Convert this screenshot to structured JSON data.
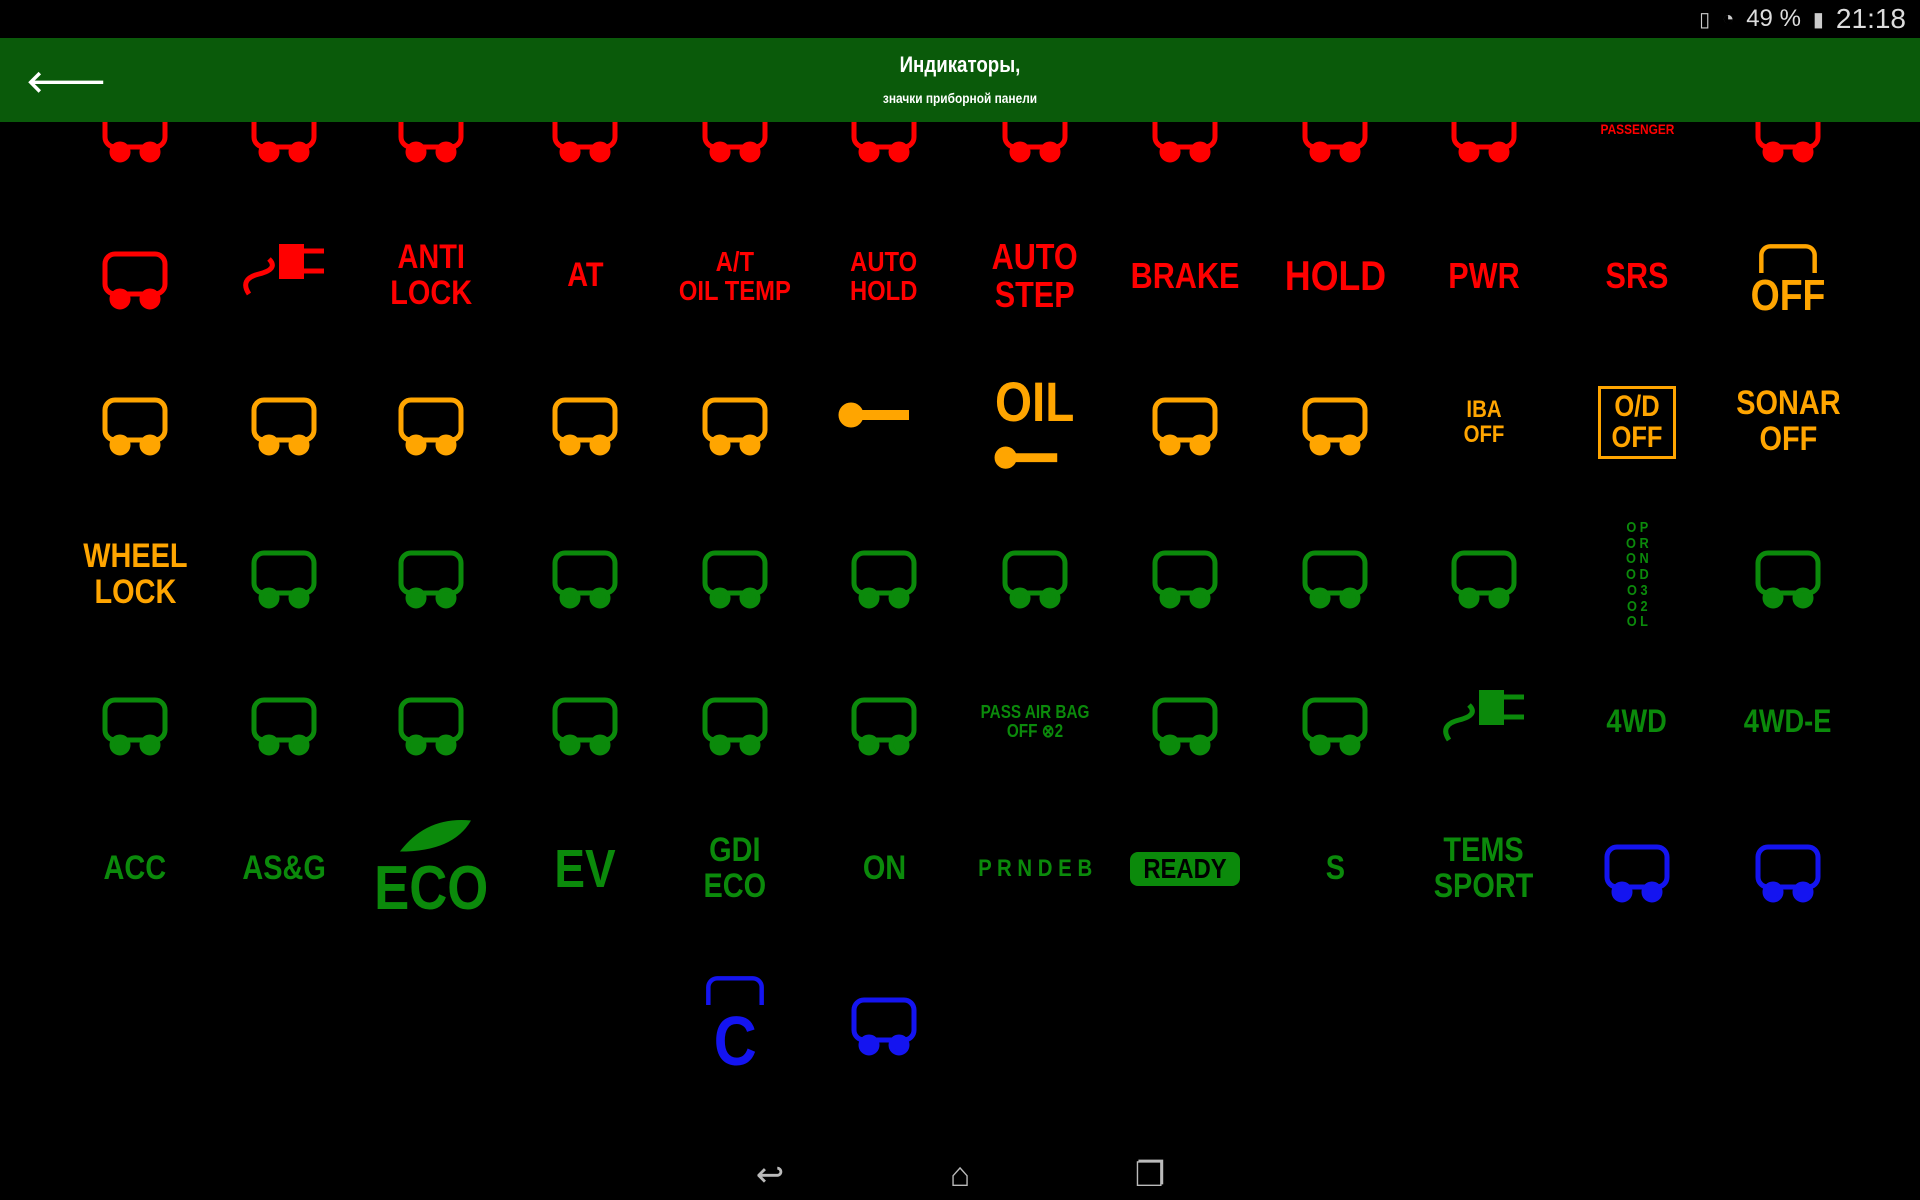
{
  "status_bar": {
    "battery": "49 %",
    "time": "21:18",
    "icons": [
      "vibrate-icon",
      "wifi-icon",
      "battery-icon"
    ]
  },
  "header": {
    "title": "Индикаторы,",
    "subtitle": "значки приборной панели",
    "back_icon": "arrow-left-icon"
  },
  "colors": {
    "red": "#ff0000",
    "orange": "#ffa500",
    "green": "#0b8a0b",
    "blue": "#1414f0",
    "header": "#0a5a0a"
  },
  "rows": [
    [
      {
        "c": "red",
        "icon": "seat-heater"
      },
      {
        "c": "red",
        "icon": "coolant-level"
      },
      {
        "c": "red",
        "icon": "gear-warning"
      },
      {
        "c": "red",
        "icon": "fuel"
      },
      {
        "c": "red",
        "icon": "washer-level"
      },
      {
        "c": "red",
        "icon": "battery"
      },
      {
        "c": "red",
        "icon": "trunk-open"
      },
      {
        "c": "red",
        "icon": "glow-plug"
      },
      {
        "c": "red",
        "icon": "oil-can"
      },
      {
        "c": "red",
        "icon": "seatbelt"
      },
      {
        "c": "red",
        "text": [
          "PASSENGER"
        ],
        "s": 14
      },
      {
        "c": "red",
        "icon": "airbag"
      }
    ],
    [
      {
        "c": "red",
        "icon": "glow-heater"
      },
      {
        "c": "red",
        "icon": "plug"
      },
      {
        "c": "red",
        "text": [
          "ANTI",
          "LOCK"
        ],
        "s": 34
      },
      {
        "c": "red",
        "text": [
          "AT"
        ],
        "s": 34
      },
      {
        "c": "red",
        "text": [
          "A/T",
          "OIL TEMP"
        ],
        "s": 28
      },
      {
        "c": "red",
        "text": [
          "AUTO",
          "HOLD"
        ],
        "s": 28
      },
      {
        "c": "red",
        "text": [
          "AUTO",
          "STEP"
        ],
        "s": 36
      },
      {
        "c": "red",
        "text": [
          "BRAKE"
        ],
        "s": 36
      },
      {
        "c": "red",
        "text": [
          "HOLD"
        ],
        "s": 42
      },
      {
        "c": "red",
        "text": [
          "PWR"
        ],
        "s": 36
      },
      {
        "c": "red",
        "text": [
          "SRS"
        ],
        "s": 36
      },
      {
        "c": "orange",
        "icon": "sonar-car",
        "text": [
          "OFF"
        ],
        "s": 44
      }
    ],
    [
      {
        "c": "orange",
        "icon": "lane-car"
      },
      {
        "c": "orange",
        "icon": "rear-fog"
      },
      {
        "c": "orange",
        "icon": "windshield-washer"
      },
      {
        "c": "orange",
        "icon": "oil-drip"
      },
      {
        "c": "orange",
        "icon": "coolant-tank"
      },
      {
        "c": "orange",
        "icon": "wrench"
      },
      {
        "c": "orange",
        "text": [
          "OIL"
        ],
        "s": 56,
        "icon2": "wrench"
      },
      {
        "c": "orange",
        "icon": "engine"
      },
      {
        "c": "orange",
        "icon": "brake-circle"
      },
      {
        "c": "orange",
        "text": [
          "IBA",
          "OFF"
        ],
        "s": 24
      },
      {
        "c": "orange",
        "text": [
          "O/D",
          "OFF"
        ],
        "s": 30,
        "boxed": true
      },
      {
        "c": "orange",
        "text": [
          "SONAR",
          "OFF"
        ],
        "s": 34
      }
    ],
    [
      {
        "c": "orange",
        "text": [
          "WHEEL",
          "LOCK"
        ],
        "s": 34
      },
      {
        "c": "green",
        "icon": "auto-stop"
      },
      {
        "c": "green",
        "icon": "parking-p"
      },
      {
        "c": "green",
        "icon": "drivetrain"
      },
      {
        "c": "green",
        "icon": "drivetrain-full"
      },
      {
        "c": "green",
        "icon": "axle"
      },
      {
        "c": "green",
        "icon": "diff-lock"
      },
      {
        "c": "green",
        "icon": "4wd-box"
      },
      {
        "c": "green",
        "icon": "4l-box"
      },
      {
        "c": "green",
        "icon": "car-arrows"
      },
      {
        "c": "green",
        "text": [
          "O P",
          "O R",
          "O N",
          "O D",
          "O 3",
          "O 2",
          "O L"
        ],
        "s": 15
      },
      {
        "c": "green",
        "icon": "sonar-car"
      }
    ],
    [
      {
        "c": "green",
        "icon": "car-front"
      },
      {
        "c": "green",
        "icon": "parking-sensors"
      },
      {
        "c": "green",
        "icon": "lane-assist"
      },
      {
        "c": "green",
        "icon": "lane-car"
      },
      {
        "c": "green",
        "icon": "side-lights"
      },
      {
        "c": "green",
        "icon": "front-fog"
      },
      {
        "c": "green",
        "text": [
          "PASS AIR BAG",
          "OFF ⊗2"
        ],
        "s": 18
      },
      {
        "c": "green",
        "icon": "turn-signals"
      },
      {
        "c": "green",
        "icon": "tire-arrow"
      },
      {
        "c": "green",
        "icon": "plug"
      },
      {
        "c": "green",
        "text": [
          "4WD"
        ],
        "s": 32
      },
      {
        "c": "green",
        "text": [
          "4WD-E"
        ],
        "s": 32
      }
    ],
    [
      {
        "c": "green",
        "text": [
          "ACC"
        ],
        "s": 34
      },
      {
        "c": "green",
        "text": [
          "AS&G"
        ],
        "s": 34
      },
      {
        "c": "green",
        "text": [
          "ECO"
        ],
        "s": 62,
        "icon2": "leaf"
      },
      {
        "c": "green",
        "text": [
          "EV"
        ],
        "s": 54
      },
      {
        "c": "green",
        "text": [
          "GDI",
          "ECO"
        ],
        "s": 34
      },
      {
        "c": "green",
        "text": [
          "ON"
        ],
        "s": 34
      },
      {
        "c": "green",
        "text": [
          "P R N D E B"
        ],
        "s": 24
      },
      {
        "c": "green",
        "text": [
          "READY"
        ],
        "s": 28,
        "pill": true
      },
      {
        "c": "green",
        "text": [
          "S"
        ],
        "s": 34
      },
      {
        "c": "green",
        "text": [
          "TEMS",
          "SPORT"
        ],
        "s": 34
      },
      {
        "c": "blue",
        "icon": "high-beam"
      },
      {
        "c": "blue",
        "icon": "auto-high-beam"
      }
    ],
    [
      null,
      null,
      null,
      null,
      {
        "c": "blue",
        "icon": "coolant-cold",
        "text": [
          "C"
        ],
        "s": 70
      },
      {
        "c": "blue",
        "icon": "coolant-temp"
      },
      null,
      null,
      null,
      null,
      null,
      null
    ]
  ]
}
